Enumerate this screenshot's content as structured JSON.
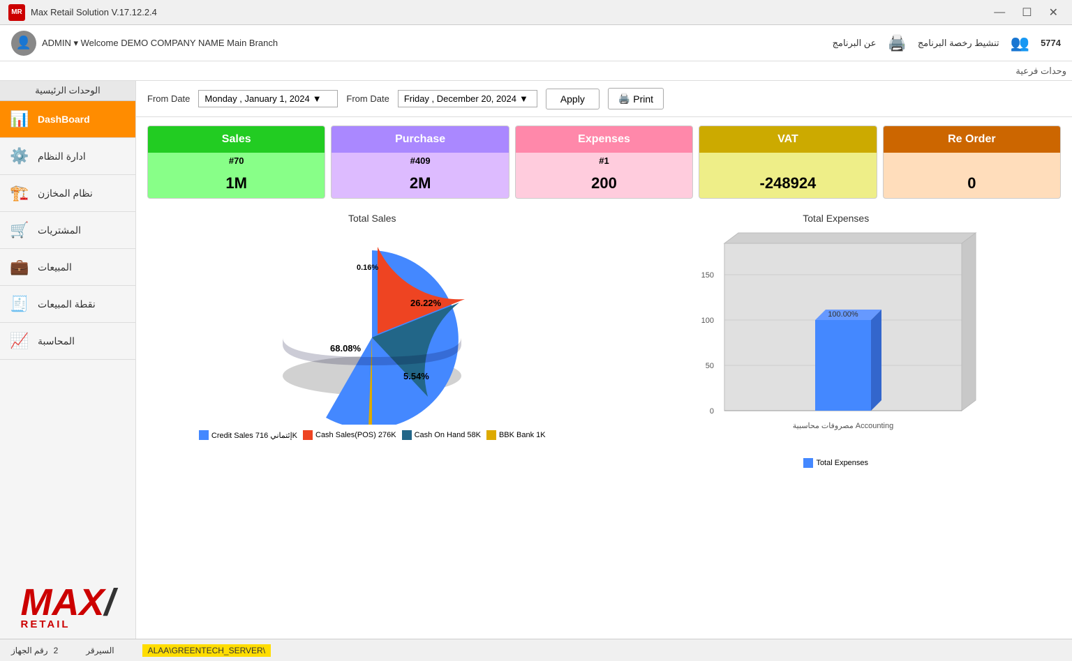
{
  "titlebar": {
    "logo": "MR",
    "title": "Max Retail Solution V.17.12.2.4",
    "minimize": "—",
    "maximize": "☐",
    "close": "✕"
  },
  "header": {
    "admin_label": "ADMIN ▾  Welcome  DEMO COMPANY NAME  Main Branch",
    "right_count": "5774",
    "activate_label": "تنشيط رخصة البرنامج",
    "about_label": "عن البرنامج"
  },
  "sidebar": {
    "header": "الوحدات الرئيسية",
    "subunits_label": "وحدات فرعية",
    "items": [
      {
        "id": "dashboard",
        "label": "DashBoard",
        "icon": "📊",
        "active": true
      },
      {
        "id": "system",
        "label": "ادارة النظام",
        "icon": "⚙️",
        "active": false
      },
      {
        "id": "warehouse",
        "label": "نظام المخازن",
        "icon": "🏗️",
        "active": false
      },
      {
        "id": "purchases",
        "label": "المشتريات",
        "icon": "🛒",
        "active": false
      },
      {
        "id": "sales",
        "label": "المبيعات",
        "icon": "💼",
        "active": false
      },
      {
        "id": "pos",
        "label": "نقطة المبيعات",
        "icon": "🧾",
        "active": false
      },
      {
        "id": "accounting",
        "label": "المحاسبة",
        "icon": "📈",
        "active": false
      }
    ],
    "logo": {
      "max": "MAX",
      "retail": "RETAIL"
    }
  },
  "toolbar": {
    "from_date_label": "From Date",
    "from_date_value": "Monday  ,  January  1, 2024",
    "to_date_label": "From Date",
    "to_date_value": "Friday  ,  December 20, 2024",
    "apply_label": "Apply",
    "print_label": "Print"
  },
  "cards": [
    {
      "id": "sales",
      "title": "Sales",
      "count": "#70",
      "value": "1M",
      "class": "card-sales"
    },
    {
      "id": "purchase",
      "title": "Purchase",
      "count": "#409",
      "value": "2M",
      "class": "card-purchase"
    },
    {
      "id": "expenses",
      "title": "Expenses",
      "count": "#1",
      "value": "200",
      "class": "card-expenses"
    },
    {
      "id": "vat",
      "title": "VAT",
      "count": "",
      "value": "-248924",
      "class": "card-vat"
    },
    {
      "id": "reorder",
      "title": "Re Order",
      "count": "",
      "value": "0",
      "class": "card-reorder"
    }
  ],
  "pie_chart": {
    "title": "Total Sales",
    "segments": [
      {
        "label": "Credit Sales",
        "percent": 68.08,
        "color": "#4488ff",
        "value": "716K"
      },
      {
        "label": "Cash Sales(POS)",
        "percent": 26.22,
        "color": "#ee4422",
        "value": "276K"
      },
      {
        "label": "Cash On Hand",
        "percent": 5.54,
        "color": "#226688",
        "value": "58K"
      },
      {
        "label": "BBK Bank",
        "percent": 0.16,
        "color": "#ddaa00",
        "value": "1K"
      }
    ]
  },
  "bar_chart": {
    "title": "Total Expenses",
    "y_labels": [
      "0",
      "50",
      "100",
      "150"
    ],
    "bars": [
      {
        "label": "مصروفات محاسبية Accounting",
        "value": 100,
        "percent": "100.00%",
        "color": "#4488ff"
      }
    ],
    "legend_label": "Total Expenses",
    "legend_color": "#4488ff"
  },
  "statusbar": {
    "device_label": "رقم الجهاز",
    "device_value": "2",
    "server_label": "السيرقر",
    "server_value": "ALAA\\GREENTECH_SERVER\\"
  }
}
